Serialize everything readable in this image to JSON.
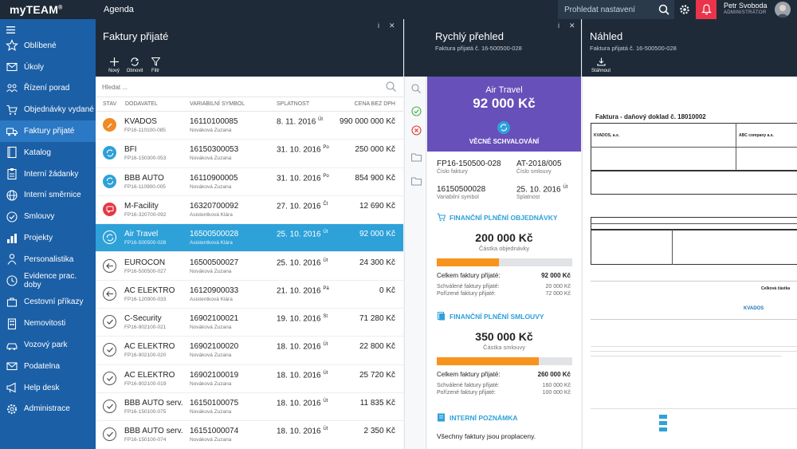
{
  "topbar": {
    "logo": "myTEAM",
    "logo_sup": "®",
    "app_title": "Agenda",
    "search_placeholder": "Prohledat nastavení",
    "user_name": "Petr Svoboda",
    "user_role": "ADMINISTRÁTOR",
    "bell_color": "#e9344a"
  },
  "sidebar": {
    "items": [
      {
        "label": "Oblíbené",
        "icon": "star-icon"
      },
      {
        "label": "Úkoly",
        "icon": "mail-icon"
      },
      {
        "label": "Řízení porad",
        "icon": "meeting-icon"
      },
      {
        "label": "Objednávky vydané",
        "icon": "cart-icon"
      },
      {
        "label": "Faktury přijaté",
        "icon": "truck-icon",
        "active": true
      },
      {
        "label": "Katalog",
        "icon": "book-icon"
      },
      {
        "label": "Interní žádanky",
        "icon": "clipboard-icon"
      },
      {
        "label": "Interní směrnice",
        "icon": "globe-icon"
      },
      {
        "label": "Smlouvy",
        "icon": "contract-icon"
      },
      {
        "label": "Projekty",
        "icon": "projects-icon"
      },
      {
        "label": "Personalistika",
        "icon": "person-icon"
      },
      {
        "label": "Evidence prac. doby",
        "icon": "clock-icon"
      },
      {
        "label": "Cestovní příkazy",
        "icon": "travel-icon"
      },
      {
        "label": "Nemovitosti",
        "icon": "building-icon"
      },
      {
        "label": "Vozový park",
        "icon": "car-icon"
      },
      {
        "label": "Podatelna",
        "icon": "envelope-icon"
      },
      {
        "label": "Help desk",
        "icon": "megaphone-icon"
      },
      {
        "label": "Administrace",
        "icon": "gear-icon"
      }
    ]
  },
  "list_panel": {
    "title": "Faktury přijaté",
    "toolbar": {
      "new": "Nový",
      "refresh": "Obnovit",
      "filter": "Filtr"
    },
    "filter_placeholder": "Hledat ...",
    "columns": [
      "STAV",
      "DODAVATEL",
      "VARIABILNÍ SYMBOL",
      "SPLATNOST",
      "CENA BEZ DPH"
    ],
    "rows": [
      {
        "status": "orange",
        "supplier": "KVADOS",
        "code": "FP16-110100-085",
        "vs": "16110100085",
        "person": "Nováková Zuzana",
        "due": "8. 11. 2016",
        "day": "Út",
        "price": "990 000 000 Kč"
      },
      {
        "status": "blue",
        "supplier": "BFI",
        "code": "FP16-150300-053",
        "vs": "16150300053",
        "person": "Nováková Zuzana",
        "due": "31. 10. 2016",
        "day": "Po",
        "price": "250 000 Kč"
      },
      {
        "status": "blue",
        "supplier": "BBB AUTO",
        "code": "FP16-110900-005",
        "vs": "16110900005",
        "person": "Nováková Zuzana",
        "due": "31. 10. 2016",
        "day": "Po",
        "price": "854 900 Kč"
      },
      {
        "status": "red",
        "supplier": "M-Facility",
        "code": "FP16-320700-092",
        "vs": "16320700092",
        "person": "Asistentková Klára",
        "due": "27. 10. 2016",
        "day": "Čt",
        "price": "12 690 Kč"
      },
      {
        "status": "blue",
        "supplier": "Air Travel",
        "code": "FP16-500500-028",
        "vs": "16500500028",
        "person": "Asistentková Klára",
        "due": "25. 10. 2016",
        "day": "Út",
        "price": "92 000 Kč",
        "selected": true
      },
      {
        "status": "back",
        "supplier": "EUROCON",
        "code": "FP16-500500-027",
        "vs": "16500500027",
        "person": "Nováková Zuzana",
        "due": "25. 10. 2016",
        "day": "Út",
        "price": "24 300 Kč"
      },
      {
        "status": "back",
        "supplier": "AC ELEKTRO",
        "code": "FP16-120900-033",
        "vs": "16120900033",
        "person": "Asistentková Klára",
        "due": "21. 10. 2016",
        "day": "Pá",
        "price": "0 Kč"
      },
      {
        "status": "check",
        "supplier": "C-Security",
        "code": "FP16-902100-021",
        "vs": "16902100021",
        "person": "Nováková Zuzana",
        "due": "19. 10. 2016",
        "day": "St",
        "price": "71 280 Kč"
      },
      {
        "status": "check",
        "supplier": "AC ELEKTRO",
        "code": "FP16-902100-020",
        "vs": "16902100020",
        "person": "Nováková Zuzana",
        "due": "18. 10. 2016",
        "day": "Út",
        "price": "22 800 Kč"
      },
      {
        "status": "check",
        "supplier": "AC ELEKTRO",
        "code": "FP16-902100-019",
        "vs": "16902100019",
        "person": "Nováková Zuzana",
        "due": "18. 10. 2016",
        "day": "Út",
        "price": "25 720 Kč"
      },
      {
        "status": "check",
        "supplier": "BBB AUTO serv.",
        "code": "FP16-150100-075",
        "vs": "16150100075",
        "person": "Nováková Zuzana",
        "due": "18. 10. 2016",
        "day": "Út",
        "price": "11 835 Kč"
      },
      {
        "status": "check",
        "supplier": "BBB AUTO serv.",
        "code": "FP16-150100-074",
        "vs": "16151000074",
        "person": "Nováková Zuzana",
        "due": "18. 10. 2016",
        "day": "Út",
        "price": "2 350 Kč"
      }
    ]
  },
  "quick_panel": {
    "title": "Rychlý přehled",
    "subtitle": "Faktura přijatá č. 16-500500-028",
    "supplier": "Air Travel",
    "amount": "92 000 Kč",
    "state": "VĚCNÉ SCHVALOVÁNÍ",
    "invoice_no": "FP16-150500-028",
    "invoice_no_label": "Číslo faktury",
    "contract_no": "AT-2018/005",
    "contract_no_label": "Číslo smlouvy",
    "vs": "16150500028",
    "vs_label": "Variabilní symbol",
    "due": "25. 10. 2016",
    "day": "Út",
    "due_label": "Splatnost",
    "order": {
      "heading": "FINANČNÍ PLNĚNÍ OBJEDNÁVKY",
      "amount": "200 000 Kč",
      "amount_label": "Částka objednávky",
      "progress": 0.46,
      "total_label": "Celkem faktury přijaté:",
      "total": "92 000 Kč",
      "approved_label": "Schválené faktury přijaté:",
      "approved": "20 000 Kč",
      "booked_label": "Pořízené faktury přijaté:",
      "booked": "72 000 Kč"
    },
    "contract": {
      "heading": "FINANČNÍ PLNĚNÍ SMLOUVY",
      "amount": "350 000 Kč",
      "amount_label": "Částka smlouvy",
      "progress": 0.75,
      "total_label": "Celkem faktury přijaté:",
      "total": "260 000 Kč",
      "approved_label": "Schválené faktury přijaté:",
      "approved": "160 000 Kč",
      "booked_label": "Pořízené faktury přijaté:",
      "booked": "100 000 Kč"
    },
    "note_heading": "INTERNÍ POZNÁMKA",
    "note": "Všechny faktury jsou proplaceny."
  },
  "preview_panel": {
    "title": "Náhled",
    "subtitle": "Faktura přijatá č. 16-500500-028",
    "download": "Stáhnout",
    "doc_title": "Faktura - daňový doklad č. 18010002",
    "doc_supplier": "KVADOS, a.s.",
    "doc_customer": "ABC company a.s.",
    "doc_total": "Celková částka",
    "doc_logo": "KVADOS"
  },
  "colors": {
    "sidebar": "#1b5fa6",
    "header": "#1e2a38",
    "selected_row": "#2ea1d9",
    "quick_header": "#6750b9",
    "progress": "#f7941d"
  }
}
